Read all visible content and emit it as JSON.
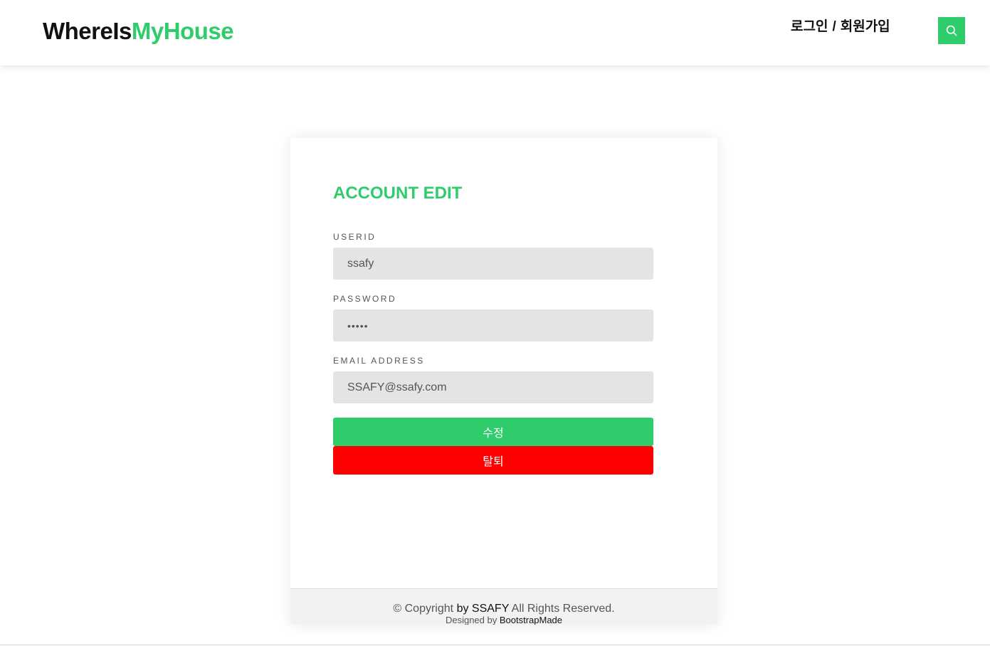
{
  "header": {
    "logo_part1": "WhereIs",
    "logo_part2": "MyHouse",
    "login_label": "로그인",
    "separator": "/",
    "signup_label": "회원가입",
    "search_icon": "search-icon"
  },
  "form": {
    "title": "ACCOUNT EDIT",
    "userid_label": "USERID",
    "userid_value": "ssafy",
    "password_label": "PASSWORD",
    "password_value": "ssafy",
    "email_label": "EMAIL ADDRESS",
    "email_value": "SSAFY@ssafy.com",
    "edit_button": "수정",
    "delete_button": "탈퇴"
  },
  "footer": {
    "copyright_prefix": "© Copyright",
    "copyright_owner": "by SSAFY",
    "copyright_suffix": "All Rights Reserved.",
    "designed_by": "Designed by",
    "designer": "BootstrapMade"
  },
  "colors": {
    "accent": "#2ecc6b",
    "danger": "#ff0000",
    "input_bg": "#e4e4e4"
  }
}
